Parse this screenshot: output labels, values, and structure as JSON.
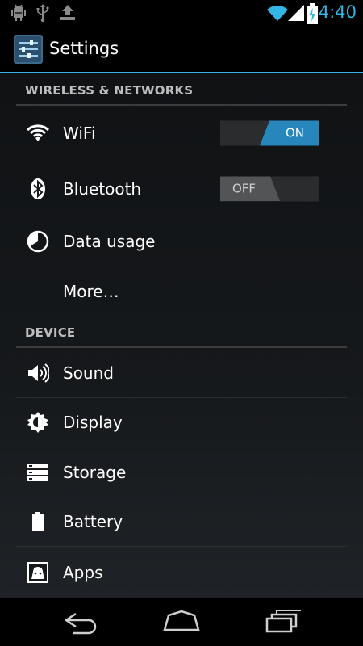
{
  "status_bar": {
    "time": "4:40",
    "left_icons": [
      "android-debug-icon",
      "usb-icon",
      "download-icon"
    ],
    "right_icons": [
      "wifi-signal-icon",
      "cell-signal-icon",
      "battery-charging-icon"
    ],
    "accent_color": "#33b5e5"
  },
  "action_bar": {
    "title": "Settings",
    "icon": "settings-app-icon"
  },
  "sections": {
    "wireless": {
      "header": "WIRELESS & NETWORKS",
      "wifi": {
        "label": "WiFi",
        "toggle": "ON",
        "state": "on"
      },
      "bluetooth": {
        "label": "Bluetooth",
        "toggle": "OFF",
        "state": "off"
      },
      "data_usage": {
        "label": "Data usage"
      },
      "more": {
        "label": "More…"
      }
    },
    "device": {
      "header": "DEVICE",
      "sound": {
        "label": "Sound"
      },
      "display": {
        "label": "Display"
      },
      "storage": {
        "label": "Storage"
      },
      "battery": {
        "label": "Battery"
      },
      "apps": {
        "label": "Apps"
      }
    }
  },
  "nav_bar": {
    "buttons": [
      "back-icon",
      "home-icon",
      "recent-apps-icon"
    ]
  }
}
